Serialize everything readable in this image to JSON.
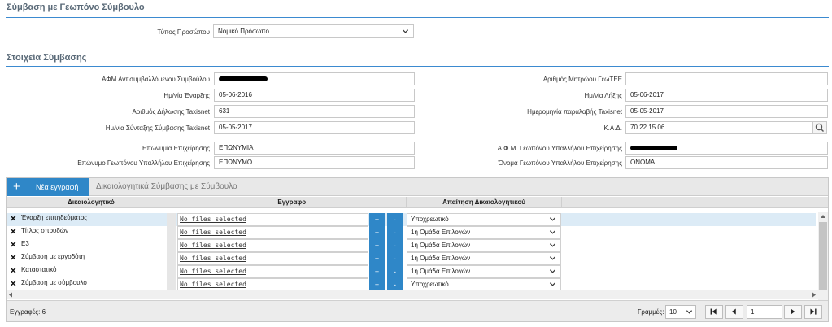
{
  "section1": {
    "title": "Σύμβαση με Γεωπόνο Σύμβουλο",
    "person_type_label": "Τύπος Προσώπου",
    "person_type_value": "Νομικό Πρόσωπο"
  },
  "section2": {
    "title": "Στοιχεία Σύμβασης",
    "afm_label": "ΑΦΜ Αντισυμβαλλόμενου Συμβούλου",
    "geotee_label": "Αριθμός Μητρώου ΓεωΤΕΕ",
    "geotee_value": "",
    "start_label": "Ημ/νία Έναρξης",
    "start_value": "05-06-2016",
    "end_label": "Ημ/νία Λήξης",
    "end_value": "05-06-2017",
    "taxisnet_num_label": "Αριθμός Δήλωσης Taxisnet",
    "taxisnet_num_value": "631",
    "taxisnet_recv_label": "Ημερομηνία παραλαβής Taxisnet",
    "taxisnet_recv_value": "05-05-2017",
    "taxisnet_date_label": "Ημ/νία Σύνταξης Σύμβασης Taxisnet",
    "taxisnet_date_value": "05-05-2017",
    "kad_label": "Κ.Α.Δ.",
    "kad_value": "70.22.15.06",
    "company_label": "Επωνυμία Επιχείρησης",
    "company_value": "ΕΠΩΝΥΜΙΑ",
    "employee_afm_label": "Α.Φ.Μ. Γεωπόνου Υπαλλήλου Επιχείρησης",
    "employee_surname_label": "Επώνυμο Γεωπόνου Υπαλλήλου Επιχείρησης",
    "employee_surname_value": "ΕΠΩΝΥΜΟ",
    "employee_name_label": "Όνομα Γεωπόνου Υπαλλήλου Επιχείρησης",
    "employee_name_value": "ΟΝΟΜΑ"
  },
  "grid": {
    "new_button": "Νέα εγγραφή",
    "title": "Δικαιολογητικά Σύμβασης με Σύμβουλο",
    "columns": [
      "Δικαιολογητικό",
      "Έγγραφο",
      "Απαίτηση Δικαιολογητικού"
    ],
    "rows": [
      {
        "name": "Έναρξη επιτηδεύματος",
        "file": "No files selected",
        "requirement": "Υποχρεωτικό"
      },
      {
        "name": "Τίτλος σπουδών",
        "file": "No files selected",
        "requirement": "1η Ομάδα Επιλογών"
      },
      {
        "name": "Ε3",
        "file": "No files selected",
        "requirement": "1η Ομάδα Επιλογών"
      },
      {
        "name": "Σύμβαση με εργοδότη",
        "file": "No files selected",
        "requirement": "1η Ομάδα Επιλογών"
      },
      {
        "name": "Καταστατικό",
        "file": "No files selected",
        "requirement": "1η Ομάδα Επιλογών"
      },
      {
        "name": "Σύμβαση με σύμβουλο",
        "file": "No files selected",
        "requirement": "Υποχρεωτικό"
      }
    ],
    "plus": "+",
    "minus": "-",
    "records_label": "Εγγραφές: 6",
    "rows_label": "Γραμμές:",
    "rows_per_page": "10",
    "page": "1"
  },
  "colors": {
    "accent": "#2f87c8",
    "section_line": "#3b8ad0",
    "selected_row": "#dcebf6"
  }
}
